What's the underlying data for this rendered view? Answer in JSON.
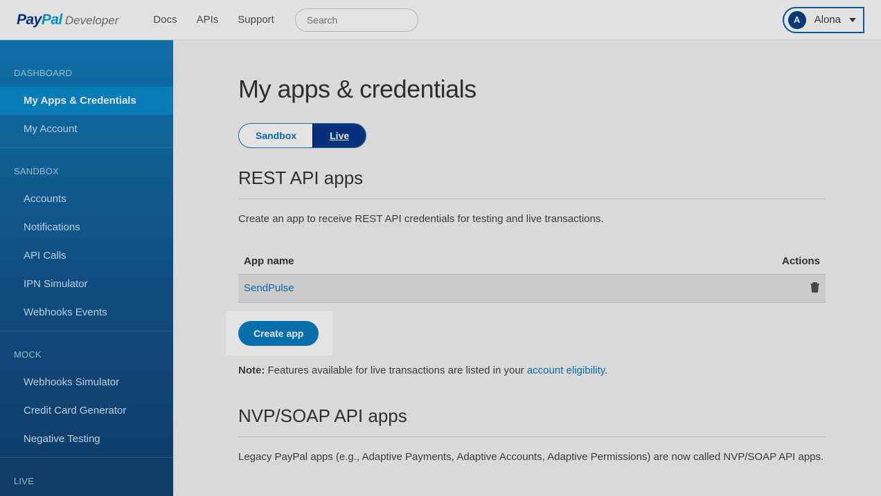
{
  "header": {
    "logo_primary": "Pay",
    "logo_secondary": "Pal",
    "logo_suffix": "Developer",
    "nav": [
      "Docs",
      "APIs",
      "Support"
    ],
    "search_placeholder": "Search",
    "user_initial": "A",
    "user_name": "Alona"
  },
  "sidebar": {
    "sections": [
      {
        "heading": "DASHBOARD",
        "items": [
          {
            "label": "My Apps & Credentials",
            "active": true
          },
          {
            "label": "My Account"
          }
        ]
      },
      {
        "heading": "SANDBOX",
        "items": [
          {
            "label": "Accounts"
          },
          {
            "label": "Notifications"
          },
          {
            "label": "API Calls"
          },
          {
            "label": "IPN Simulator"
          },
          {
            "label": "Webhooks Events"
          }
        ]
      },
      {
        "heading": "MOCK",
        "items": [
          {
            "label": "Webhooks Simulator"
          },
          {
            "label": "Credit Card Generator"
          },
          {
            "label": "Negative Testing"
          }
        ]
      },
      {
        "heading": "LIVE",
        "items": []
      }
    ]
  },
  "main": {
    "title": "My apps & credentials",
    "toggle": {
      "sandbox": "Sandbox",
      "live": "Live"
    },
    "rest_section": {
      "title": "REST API apps",
      "desc": "Create an app to receive REST API credentials for testing and live transactions.",
      "columns": {
        "name": "App name",
        "actions": "Actions"
      },
      "rows": [
        {
          "name": "SendPulse"
        }
      ],
      "create_label": "Create app",
      "note_prefix": "Note:",
      "note_text": " Features available for live transactions are listed in your ",
      "note_link": "account eligibility",
      "note_suffix": "."
    },
    "nvp_section": {
      "title": "NVP/SOAP API apps",
      "desc": "Legacy PayPal apps (e.g., Adaptive Payments, Adaptive Accounts, Adaptive Permissions) are now called NVP/SOAP API apps."
    }
  }
}
